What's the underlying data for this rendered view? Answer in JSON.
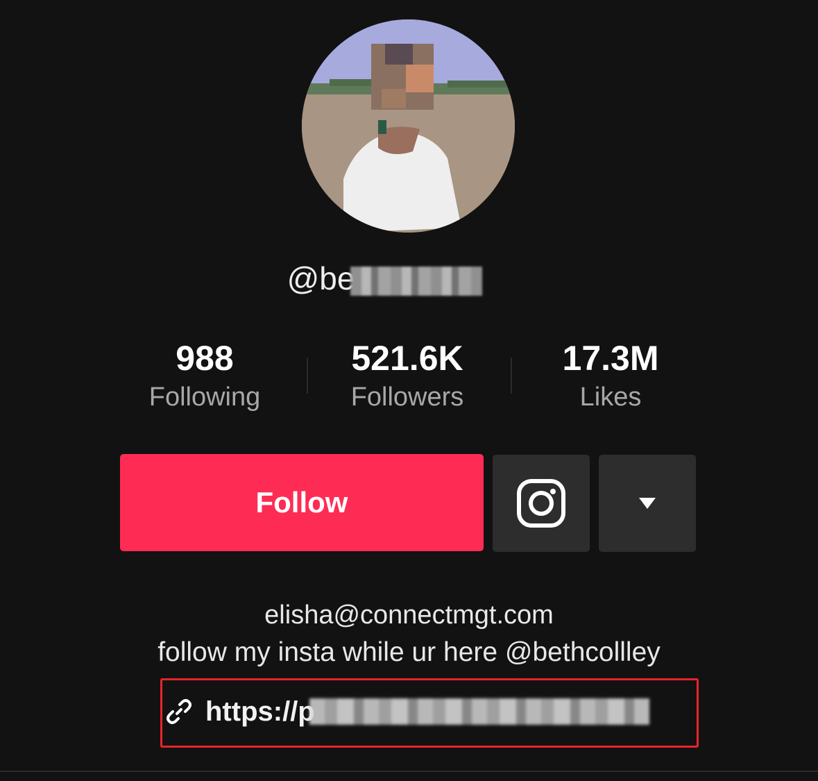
{
  "profile": {
    "username_visible": "@be",
    "stats": [
      {
        "value": "988",
        "label": "Following"
      },
      {
        "value": "521.6K",
        "label": "Followers"
      },
      {
        "value": "17.3M",
        "label": "Likes"
      }
    ]
  },
  "actions": {
    "follow_label": "Follow",
    "instagram_icon": "instagram-icon",
    "more_icon": "triangle-down-icon"
  },
  "bio": {
    "line1": "elisha@connectmgt.com",
    "line2": "follow my insta while ur here @bethcollley",
    "link_visible": "https://p",
    "link_icon": "link-icon"
  },
  "colors": {
    "accent": "#fe2c55",
    "highlight_box": "#e8242b",
    "background": "#121212"
  }
}
